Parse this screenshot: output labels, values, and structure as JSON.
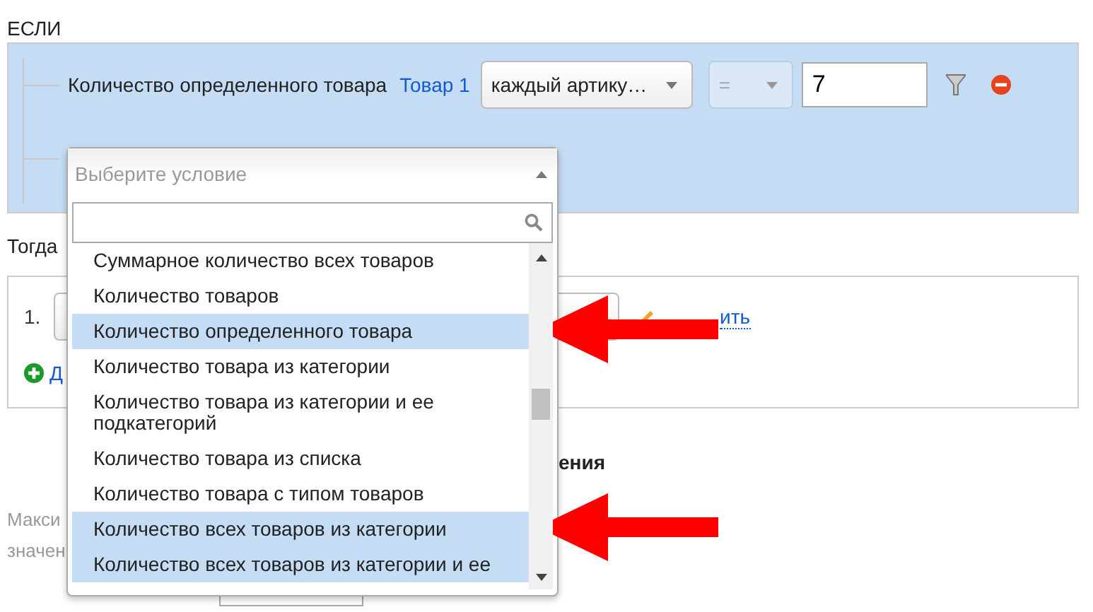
{
  "if_label": "ЕСЛИ",
  "condition": {
    "label": "Количество определенного товара",
    "link": "Товар 1",
    "mode_select": {
      "value": "каждый артику…"
    },
    "operator_select": {
      "value": "=",
      "disabled": true
    },
    "value_field": {
      "value": "7"
    }
  },
  "condition_picker": {
    "placeholder": "Выберите условие",
    "expanded": true,
    "options": [
      {
        "label": "Суммарное количество всех товаров",
        "selected": false,
        "annotated": false
      },
      {
        "label": "Количество товаров",
        "selected": false,
        "annotated": false
      },
      {
        "label": "Количество определенного товара",
        "selected": true,
        "annotated": true
      },
      {
        "label": "Количество товара из категории",
        "selected": false,
        "annotated": false
      },
      {
        "label": "Количество товара из категории и ее подкатегорий",
        "selected": false,
        "annotated": false
      },
      {
        "label": "Количество товара из списка",
        "selected": false,
        "annotated": false
      },
      {
        "label": "Количество товара с типом товаров",
        "selected": false,
        "annotated": false
      },
      {
        "label": "Количество всех товаров из категории",
        "selected": true,
        "annotated": true
      },
      {
        "label": "Количество всех товаров из категории и ее",
        "selected": true,
        "annotated": false
      }
    ]
  },
  "then_label": "Тогда",
  "actions": [
    {
      "number": "1.",
      "link": "ить"
    }
  ],
  "add_link": "Д",
  "section_heading": "ения",
  "notes": [
    "Макси",
    "значен"
  ]
}
